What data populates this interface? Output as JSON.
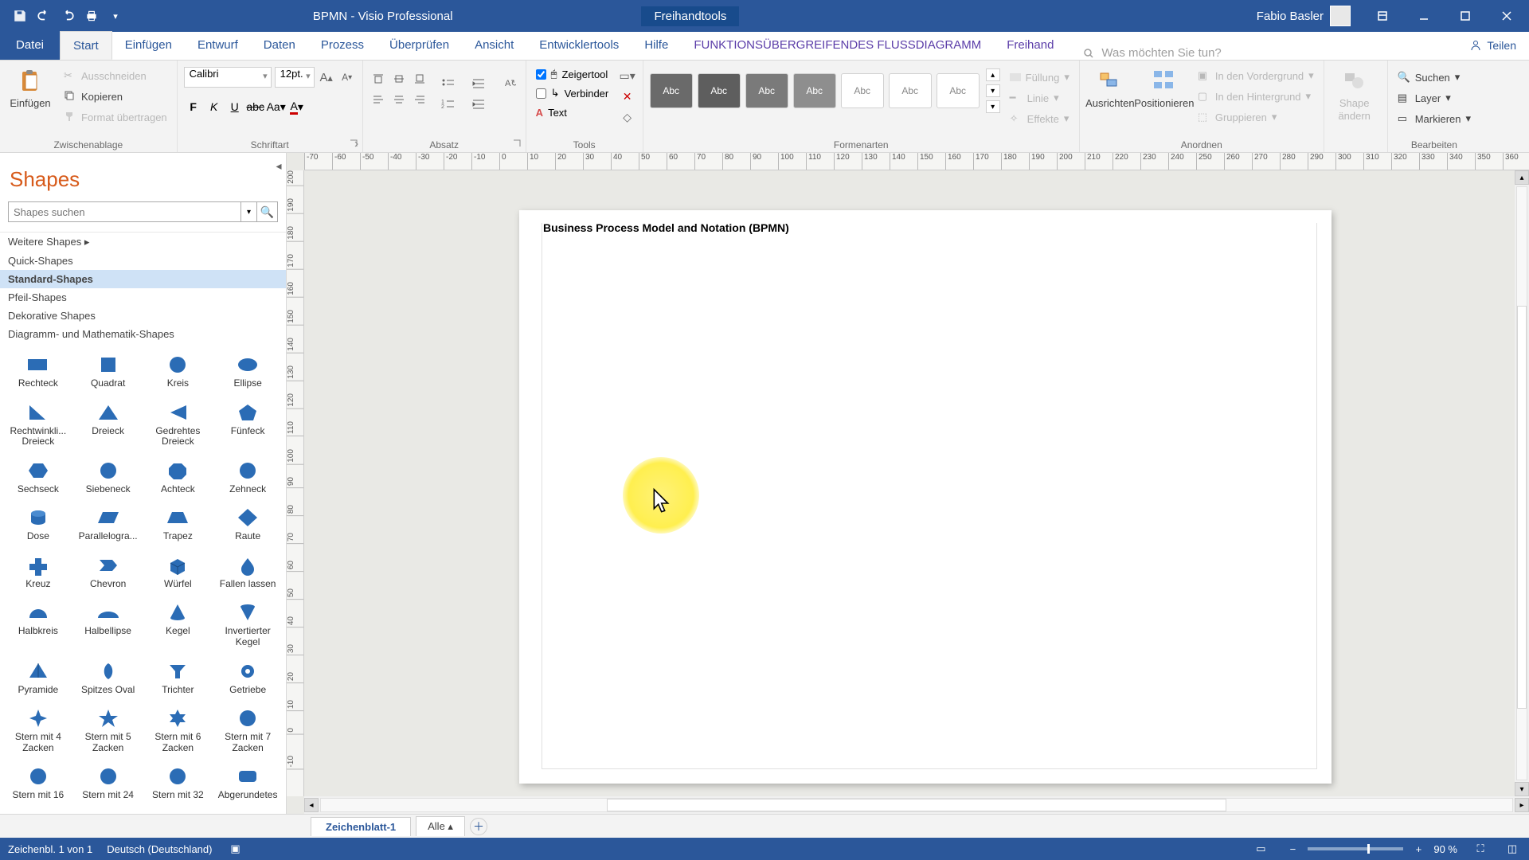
{
  "titlebar": {
    "doc": "BPMN  -  Visio Professional",
    "context_tool": "Freihandtools",
    "user": "Fabio Basler"
  },
  "tabs": {
    "file": "Datei",
    "home": "Start",
    "insert": "Einfügen",
    "design": "Entwurf",
    "data": "Daten",
    "process": "Prozess",
    "review": "Überprüfen",
    "view": "Ansicht",
    "devtools": "Entwicklertools",
    "help": "Hilfe",
    "crossfunc": "FUNKTIONSÜBERGREIFENDES FLUSSDIAGRAMM",
    "freihand": "Freihand",
    "tellme": "Was möchten Sie tun?",
    "share": "Teilen"
  },
  "ribbon": {
    "clipboard": {
      "label": "Zwischenablage",
      "paste": "Einfügen",
      "cut": "Ausschneiden",
      "copy": "Kopieren",
      "format": "Format übertragen"
    },
    "font": {
      "label": "Schriftart",
      "name": "Calibri",
      "size": "12pt."
    },
    "paragraph": {
      "label": "Absatz"
    },
    "tools": {
      "label": "Tools",
      "pointer": "Zeigertool",
      "connector": "Verbinder",
      "text": "Text"
    },
    "shape_styles": {
      "label": "Formenarten",
      "abc": "Abc",
      "fill": "Füllung",
      "line": "Linie",
      "effects": "Effekte"
    },
    "arrange": {
      "label": "Anordnen",
      "align": "Ausrichten",
      "position": "Positionieren",
      "front": "In den Vordergrund",
      "back": "In den Hintergrund",
      "group": "Gruppieren"
    },
    "change_shape": {
      "label": "",
      "btn": "Shape ändern"
    },
    "edit": {
      "label": "Bearbeiten",
      "find": "Suchen",
      "layer": "Layer",
      "select": "Markieren"
    }
  },
  "shapes_panel": {
    "title": "Shapes",
    "search_placeholder": "Shapes suchen",
    "more": "Weitere Shapes",
    "categories": [
      "Quick-Shapes",
      "Standard-Shapes",
      "Pfeil-Shapes",
      "Dekorative Shapes",
      "Diagramm- und Mathematik-Shapes"
    ],
    "selected_index": 1,
    "shapes": [
      "Rechteck",
      "Quadrat",
      "Kreis",
      "Ellipse",
      "Rechtwinkli... Dreieck",
      "Dreieck",
      "Gedrehtes Dreieck",
      "Fünfeck",
      "Sechseck",
      "Siebeneck",
      "Achteck",
      "Zehneck",
      "Dose",
      "Parallelogra...",
      "Trapez",
      "Raute",
      "Kreuz",
      "Chevron",
      "Würfel",
      "Fallen lassen",
      "Halbkreis",
      "Halbellipse",
      "Kegel",
      "Invertierter Kegel",
      "Pyramide",
      "Spitzes Oval",
      "Trichter",
      "Getriebe",
      "Stern mit 4 Zacken",
      "Stern mit 5 Zacken",
      "Stern mit 6 Zacken",
      "Stern mit 7 Zacken",
      "Stern mit 16",
      "Stern mit 24",
      "Stern mit 32",
      "Abgerundetes"
    ]
  },
  "canvas": {
    "title": "Business Process Model and Notation (BPMN)",
    "h_ticks": [
      "-70",
      "-60",
      "-50",
      "-40",
      "-30",
      "-20",
      "-10",
      "0",
      "10",
      "20",
      "30",
      "40",
      "50",
      "60",
      "70",
      "80",
      "90",
      "100",
      "110",
      "120",
      "130",
      "140",
      "150",
      "160",
      "170",
      "180",
      "190",
      "200",
      "210",
      "220",
      "230",
      "240",
      "250",
      "260",
      "270",
      "280",
      "290",
      "300",
      "310",
      "320",
      "330",
      "340",
      "350",
      "360"
    ],
    "v_ticks": [
      "200",
      "190",
      "180",
      "170",
      "160",
      "150",
      "140",
      "130",
      "120",
      "110",
      "100",
      "90",
      "80",
      "70",
      "60",
      "50",
      "40",
      "30",
      "20",
      "10",
      "0",
      "-10"
    ]
  },
  "sheet_tabs": {
    "active": "Zeichenblatt-1",
    "all": "Alle"
  },
  "statusbar": {
    "page_info": "Zeichenbl. 1 von 1",
    "language": "Deutsch (Deutschland)",
    "zoom": "90 %"
  }
}
